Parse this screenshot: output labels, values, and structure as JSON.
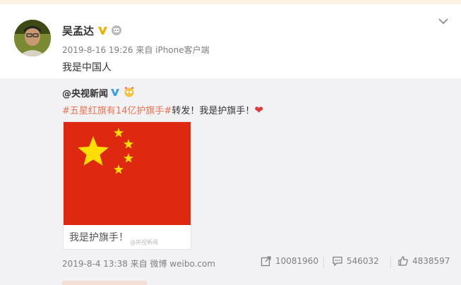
{
  "post": {
    "author": "吴孟达",
    "meta": "2019-8-16 19:26 来自 iPhone客户端",
    "text": "我是中国人"
  },
  "repost": {
    "author": "@央视新闻",
    "hashtag": "#五星红旗有14亿护旗手#",
    "text": "转发！我是护旗手！",
    "card_caption": "我是护旗手！",
    "watermark": "@央视新闻",
    "meta": "2019-8-4 13:38 来自 微博 weibo.com",
    "forward_count": "10081960",
    "comment_count": "546032",
    "like_count": "4838597"
  },
  "colors": {
    "flag_red": "#de2910",
    "star_yellow": "#ffde00",
    "hashtag": "#eb7350",
    "verified_gold": "#f6b100",
    "verified_blue": "#3a9ee8"
  }
}
